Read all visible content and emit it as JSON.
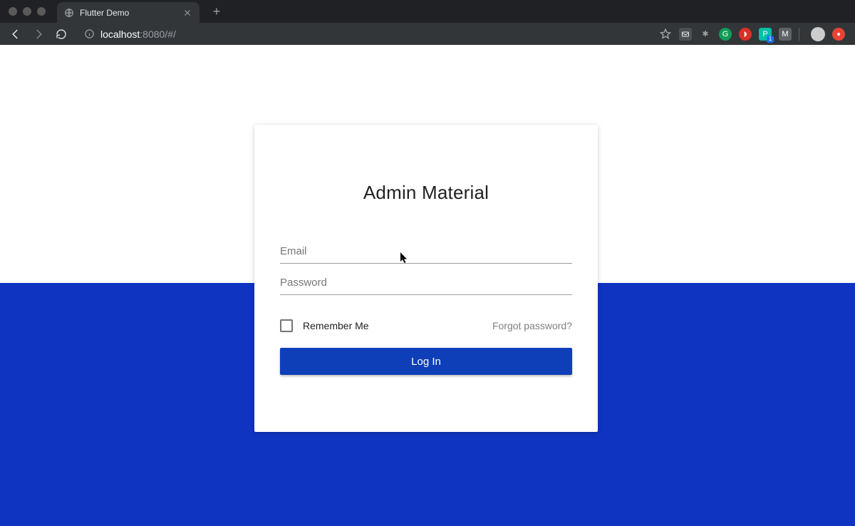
{
  "browser": {
    "tab_title": "Flutter Demo",
    "url_host": "localhost",
    "url_path": ":8080/#/",
    "new_tab_glyph": "+",
    "badge_count": "1"
  },
  "login": {
    "title": "Admin Material",
    "email_placeholder": "Email",
    "email_value": "",
    "password_placeholder": "Password",
    "password_value": "",
    "remember_label": "Remember Me",
    "forgot_label": "Forgot password?",
    "submit_label": "Log In"
  },
  "colors": {
    "accent": "#1034c2",
    "button": "#0f3fb8"
  }
}
